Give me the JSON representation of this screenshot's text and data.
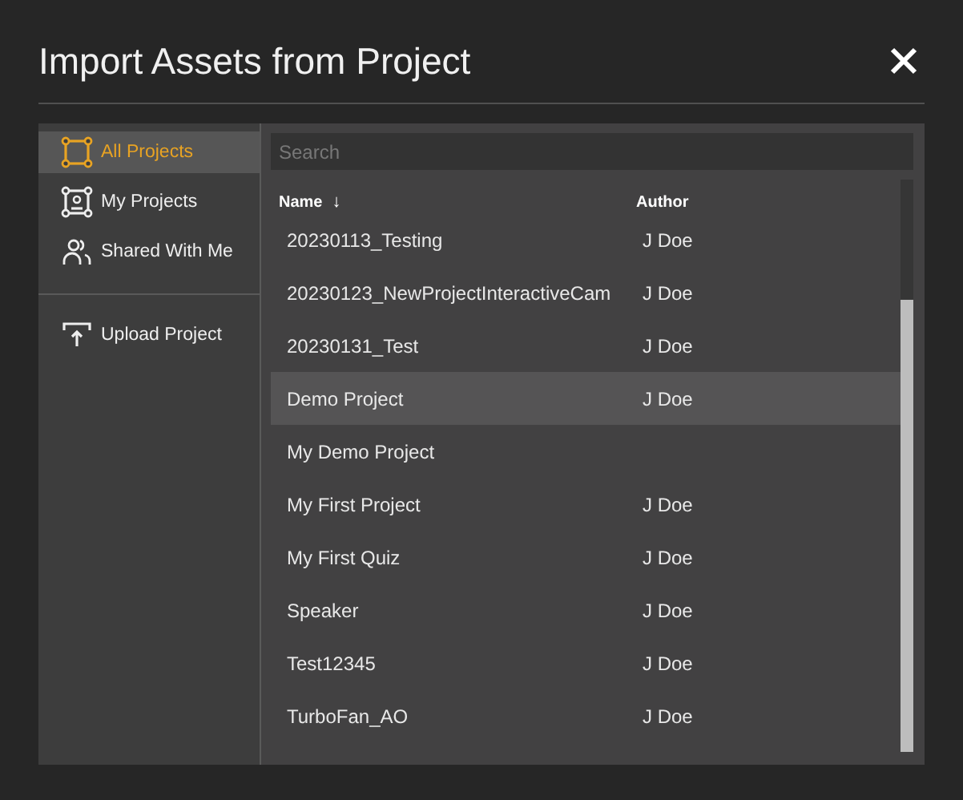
{
  "window": {
    "title": "Import Assets from Project"
  },
  "sidebar": {
    "items": [
      {
        "label": "All Projects",
        "selected": true
      },
      {
        "label": "My Projects",
        "selected": false
      },
      {
        "label": "Shared With Me",
        "selected": false
      }
    ],
    "actions": [
      {
        "label": "Upload Project"
      }
    ]
  },
  "search": {
    "placeholder": "Search"
  },
  "table": {
    "columns": [
      {
        "label": "Name",
        "sort_icon": "↓"
      },
      {
        "label": "Author"
      }
    ],
    "rows": [
      {
        "name": "20230113_Testing",
        "author": "J Doe",
        "selected": false
      },
      {
        "name": "20230123_NewProjectInteractiveCam",
        "author": "J Doe",
        "selected": false
      },
      {
        "name": "20230131_Test",
        "author": "J Doe",
        "selected": false
      },
      {
        "name": "Demo Project",
        "author": "J Doe",
        "selected": true
      },
      {
        "name": "My Demo Project",
        "selected": false
      },
      {
        "name": "My First Project",
        "author": "J Doe",
        "selected": false
      },
      {
        "name": "My First Quiz",
        "author": "J Doe",
        "selected": false
      },
      {
        "name": "Speaker",
        "author": "J Doe",
        "selected": false
      },
      {
        "name": "Test12345",
        "author": "J Doe",
        "selected": false
      },
      {
        "name": "TurboFan_AO",
        "author": "J Doe",
        "selected": false
      }
    ]
  }
}
